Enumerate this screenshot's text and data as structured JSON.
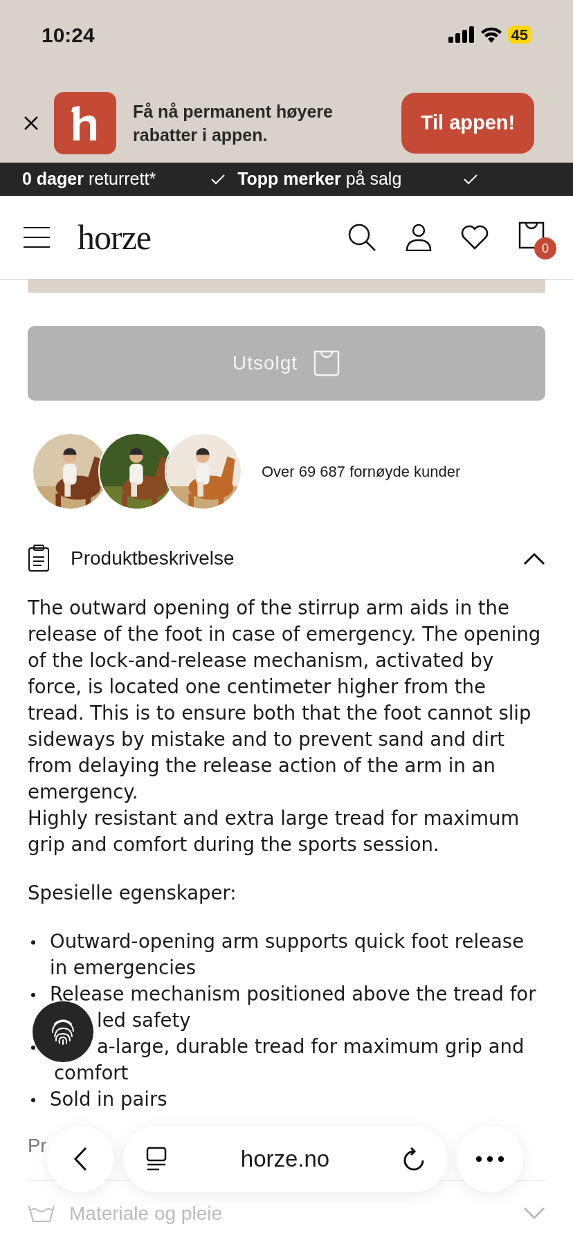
{
  "status_bar": {
    "time": "10:24",
    "battery": "45",
    "low_power": true
  },
  "app_banner": {
    "message": "Få nå permanent høyere rabatter i appen.",
    "button": "Til appen!"
  },
  "promo_strip": [
    {
      "bold": "0 dager",
      "rest": "returrett*"
    },
    {
      "bold": "Topp merker",
      "rest": "på salg"
    }
  ],
  "header": {
    "logo": "horze",
    "cart_count": "0"
  },
  "sold_out_button": {
    "label": "Utsolgt",
    "disabled": true
  },
  "customers": {
    "text": "Over 69 687 fornøyde kunder"
  },
  "description": {
    "title": "Produktbeskrivelse",
    "expanded": true,
    "paragraphs": [
      "The outward opening of the stirrup arm aids in the release of the foot in case of emergency. The opening of the lock-and-release mechanism, activated by force, is located one centimeter higher from the tread. This is to ensure both that the foot cannot slip sideways by mistake and to prevent sand and dirt from delaying the release action of the arm in an emergency.",
      "Highly resistant and extra large tread for maximum grip and comfort during the sports session."
    ],
    "features_title": "Spesielle egenskaper:",
    "features": [
      {
        "lines": [
          "Outward-opening arm supports quick foot release",
          "in emergencies"
        ]
      },
      {
        "lines": [
          "Release mechanism positioned above the tread for",
          "led safety"
        ]
      },
      {
        "lines": [
          "a-large, durable tread for maximum grip and",
          "comfort"
        ]
      },
      {
        "lines": [
          "Sold in pairs"
        ]
      }
    ],
    "product_number": "Pr"
  },
  "materials": {
    "title": "Materiale og pleie",
    "expanded": false
  },
  "browser": {
    "url": "horze.no"
  }
}
